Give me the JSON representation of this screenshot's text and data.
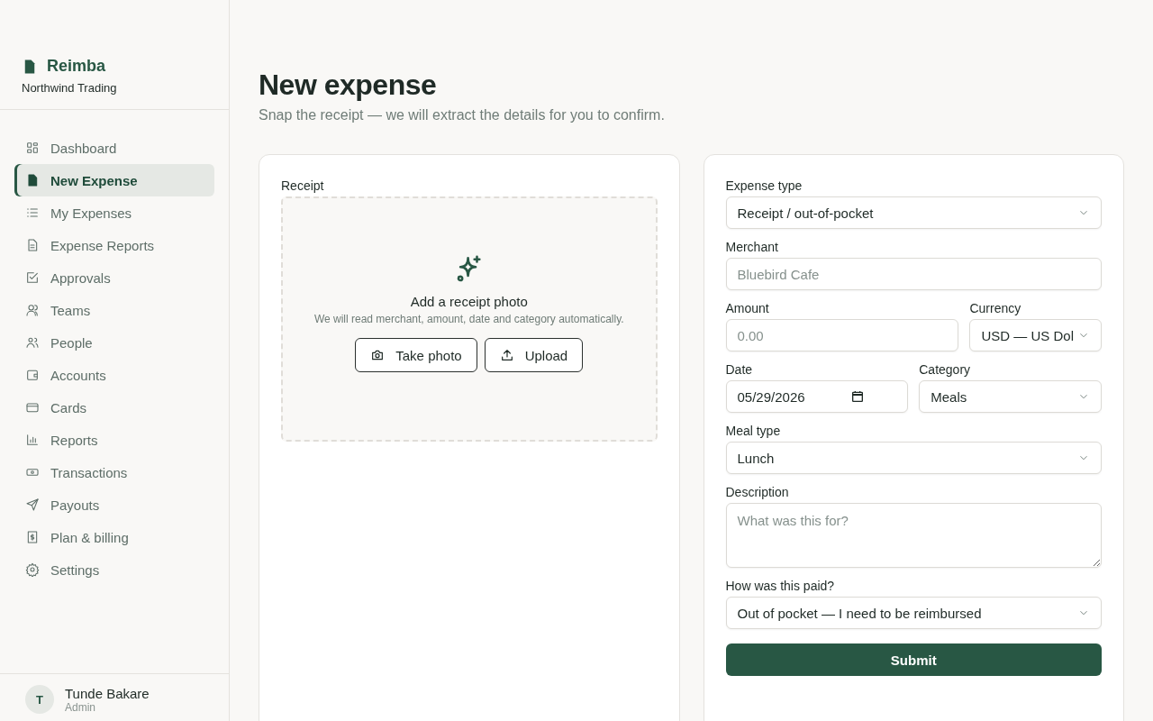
{
  "brand": {
    "name": "Reimba",
    "org": "Northwind Trading"
  },
  "nav": [
    {
      "label": "Dashboard",
      "selected": false
    },
    {
      "label": "New Expense",
      "selected": true
    },
    {
      "label": "My Expenses",
      "selected": false
    },
    {
      "label": "Expense Reports",
      "selected": false
    },
    {
      "label": "Approvals",
      "selected": false
    },
    {
      "label": "Teams",
      "selected": false
    },
    {
      "label": "People",
      "selected": false
    },
    {
      "label": "Accounts",
      "selected": false
    },
    {
      "label": "Cards",
      "selected": false
    },
    {
      "label": "Reports",
      "selected": false
    },
    {
      "label": "Transactions",
      "selected": false
    },
    {
      "label": "Payouts",
      "selected": false
    },
    {
      "label": "Plan & billing",
      "selected": false
    },
    {
      "label": "Settings",
      "selected": false
    }
  ],
  "user": {
    "initial": "T",
    "name": "Tunde Bakare",
    "role": "Admin"
  },
  "page": {
    "title": "New expense",
    "subtitle": "Snap the receipt — we will extract the details for you to confirm."
  },
  "receipt": {
    "label": "Receipt",
    "title": "Add a receipt photo",
    "hint": "We will read merchant, amount, date and category automatically.",
    "buttons": [
      "Take photo",
      "Upload"
    ]
  },
  "form": {
    "rows": [
      [
        {
          "kind": "select",
          "label": "Expense type",
          "value": "Receipt / out-of-pocket"
        }
      ],
      [
        {
          "kind": "input",
          "label": "Merchant",
          "placeholder": "Bluebird Cafe"
        }
      ],
      [
        {
          "kind": "input",
          "label": "Amount",
          "placeholder": "0.00"
        },
        {
          "kind": "select",
          "label": "Currency",
          "value": "USD — US Dol"
        }
      ],
      [
        {
          "kind": "date",
          "label": "Date",
          "value": "05/29/2026"
        },
        {
          "kind": "select",
          "label": "Category",
          "value": "Meals"
        }
      ],
      [
        {
          "kind": "select",
          "label": "Meal type",
          "value": "Lunch"
        }
      ],
      [
        {
          "kind": "textarea",
          "label": "Description",
          "placeholder": "What was this for?"
        }
      ],
      [
        {
          "kind": "select",
          "label": "How was this paid?",
          "value": "Out of pocket — I need to be reimbursed"
        }
      ]
    ],
    "submit": "Submit"
  }
}
